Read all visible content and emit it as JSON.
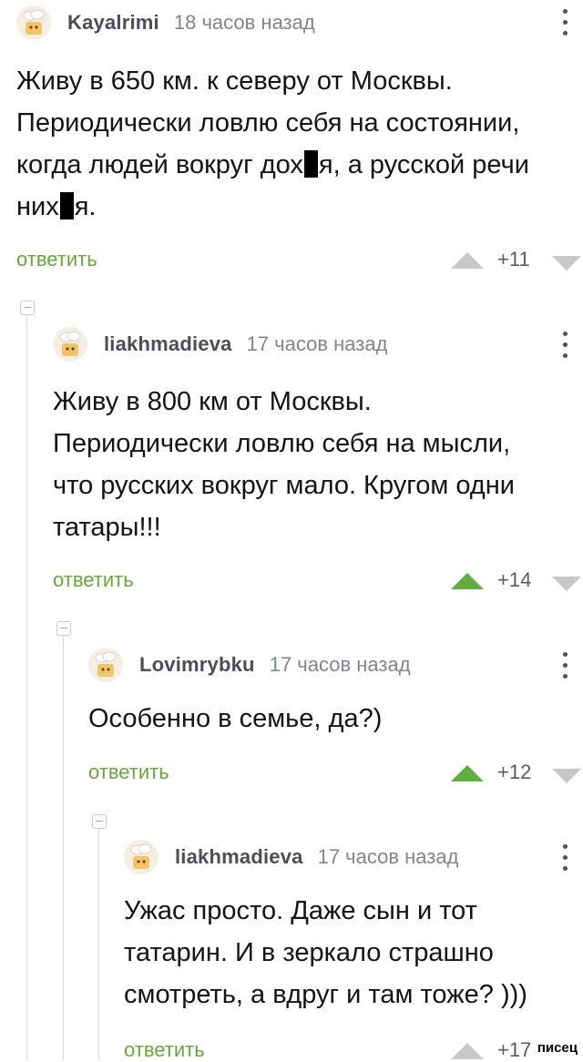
{
  "comments": [
    {
      "user": "Kayalrimi",
      "time": "18 часов назад",
      "lines": [
        "Живу в 650 км. к северу от Москвы.",
        "Периодически ловлю себя на состоянии,",
        "когда людей вокруг дох",
        "я, а русской речи",
        "них",
        "я."
      ],
      "reply": "ответить",
      "score": "+11",
      "upvoted": false
    },
    {
      "user": "liakhmadieva",
      "time": "17 часов назад",
      "lines": [
        "Живу в 800 км от Москвы.",
        "Периодически ловлю себя на мысли,",
        "что русских вокруг мало. Кругом одни",
        "татары!!!"
      ],
      "reply": "ответить",
      "score": "+14",
      "upvoted": true
    },
    {
      "user": "Lovimrybku",
      "time": "17 часов назад",
      "lines": [
        "Особенно в семье, да?)"
      ],
      "reply": "ответить",
      "score": "+12",
      "upvoted": true
    },
    {
      "user": "liakhmadieva",
      "time": "17 часов назад",
      "lines": [
        "Ужас просто. Даже сын и тот",
        "татарин. И в зеркало страшно",
        "смотреть, а вдруг и там тоже? )))"
      ],
      "reply": "ответить",
      "score": "+17",
      "upvoted": false
    }
  ],
  "watermark": "писец",
  "colors": {
    "reply": "#67a83a",
    "upvote_active": "#5fae3f",
    "vote_inactive": "#c8c8c8"
  },
  "icons": {
    "avatar": "chef-hat-avatar-icon",
    "menu": "more-vertical-icon",
    "collapse": "collapse-minus-icon",
    "upvote": "arrow-up-icon",
    "downvote": "arrow-down-icon"
  }
}
